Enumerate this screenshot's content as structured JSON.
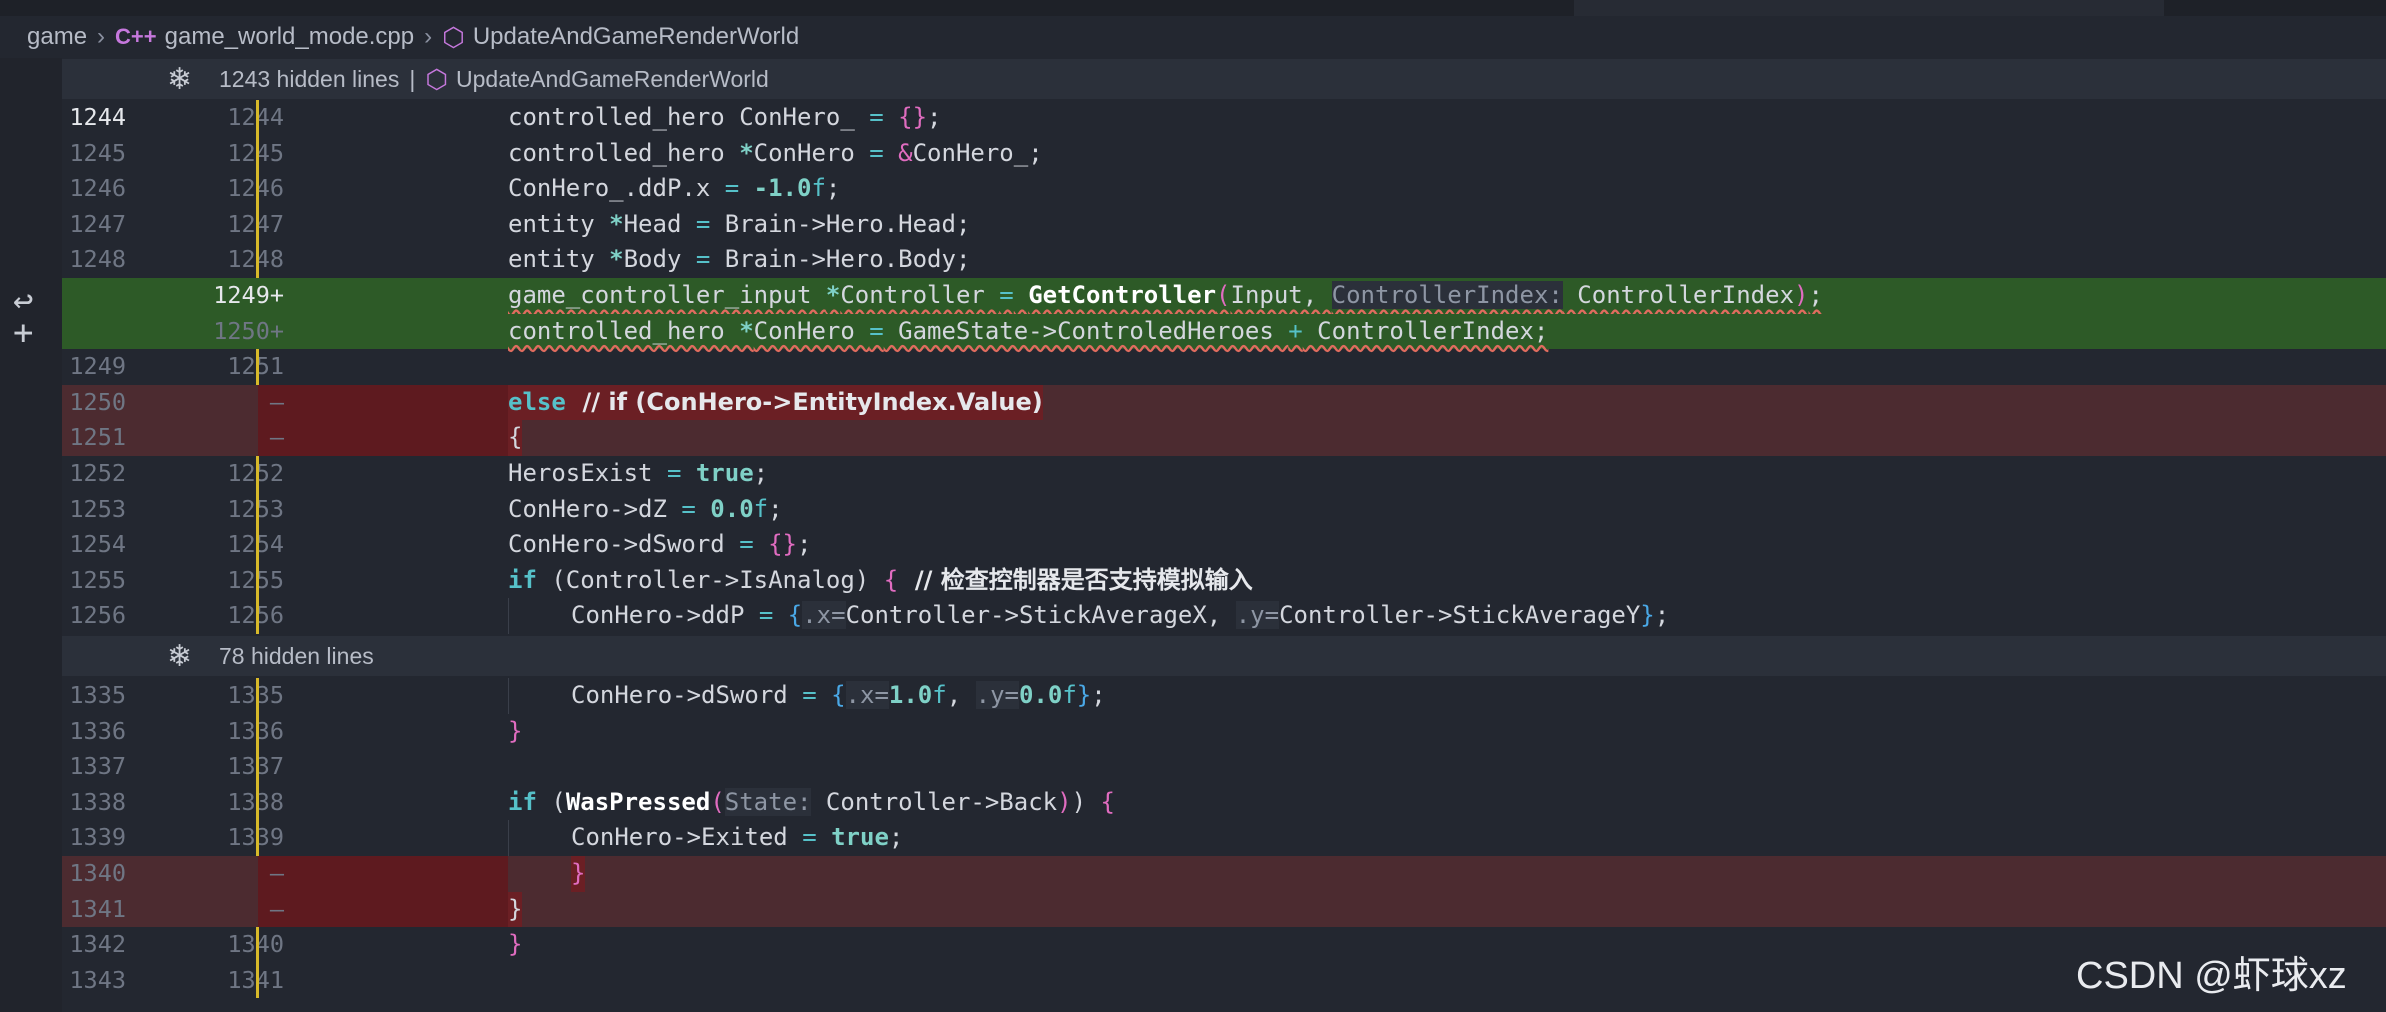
{
  "breadcrumb": {
    "folder": "game",
    "file": "game_world_mode.cpp",
    "file_icon": "C++",
    "symbol": "UpdateAndGameRenderWorld"
  },
  "banners": {
    "top": {
      "text": "1243 hidden lines",
      "symbol": "UpdateAndGameRenderWorld"
    },
    "mid": {
      "text": "78 hidden lines"
    }
  },
  "lines": [
    {
      "old": "1244",
      "new": "1244",
      "kind": "ctx",
      "active": true
    },
    {
      "old": "1245",
      "new": "1245",
      "kind": "ctx"
    },
    {
      "old": "1246",
      "new": "1246",
      "kind": "ctx"
    },
    {
      "old": "1247",
      "new": "1247",
      "kind": "ctx"
    },
    {
      "old": "1248",
      "new": "1248",
      "kind": "ctx"
    },
    {
      "old": "",
      "new": "1249+",
      "kind": "add",
      "active": true
    },
    {
      "old": "",
      "new": "1250+",
      "kind": "add"
    },
    {
      "old": "1249",
      "new": "1251",
      "kind": "ctx"
    },
    {
      "old": "1250",
      "new": "—",
      "kind": "del"
    },
    {
      "old": "1251",
      "new": "—",
      "kind": "del"
    },
    {
      "old": "1252",
      "new": "1252",
      "kind": "ctx"
    },
    {
      "old": "1253",
      "new": "1253",
      "kind": "ctx"
    },
    {
      "old": "1254",
      "new": "1254",
      "kind": "ctx"
    },
    {
      "old": "1255",
      "new": "1255",
      "kind": "ctx"
    },
    {
      "old": "1256",
      "new": "1256",
      "kind": "ctx"
    },
    {
      "old": "1335",
      "new": "1335",
      "kind": "ctx"
    },
    {
      "old": "1336",
      "new": "1336",
      "kind": "ctx"
    },
    {
      "old": "1337",
      "new": "1337",
      "kind": "ctx"
    },
    {
      "old": "1338",
      "new": "1338",
      "kind": "ctx"
    },
    {
      "old": "1339",
      "new": "1339",
      "kind": "ctx"
    },
    {
      "old": "1340",
      "new": "—",
      "kind": "del"
    },
    {
      "old": "1341",
      "new": "—",
      "kind": "del"
    },
    {
      "old": "1342",
      "new": "1340",
      "kind": "ctx"
    },
    {
      "old": "1343",
      "new": "1341",
      "kind": "ctx"
    }
  ],
  "code": {
    "l0": {
      "a": "controlled_hero ConHero_ ",
      "b": "=",
      "c": " ",
      "d": "{}",
      "e": ";"
    },
    "l1": {
      "a": "controlled_hero ",
      "b": "*",
      "c": "ConHero ",
      "d": "=",
      "e": " ",
      "f": "&",
      "g": "ConHero_;"
    },
    "l2": {
      "a": "ConHero_.ddP.x ",
      "b": "=",
      "c": " ",
      "d": "-1.0",
      "e": "f",
      "f": ";"
    },
    "l3": {
      "a": "entity ",
      "b": "*",
      "c": "Head ",
      "d": "=",
      "e": " Brain->Hero.Head;"
    },
    "l4": {
      "a": "entity ",
      "b": "*",
      "c": "Body ",
      "d": "=",
      "e": " Brain->Hero.Body;"
    },
    "l5": {
      "a": "game_controller_input ",
      "b": "*",
      "c": "Controller ",
      "d": "=",
      "e": " ",
      "f": "GetController",
      "g": "(",
      "h": "Input, ",
      "i": "ControllerIndex:",
      "j": " ControllerIndex",
      "k": ")",
      "l": ";"
    },
    "l6": {
      "a": "controlled_hero ",
      "b": "*",
      "c": "ConHero ",
      "d": "=",
      "e": " GameState->ControledHeroes ",
      "f": "+",
      "g": " ControllerIndex;"
    },
    "l8": {
      "a": "else",
      "b": "  // if (ConHero->EntityIndex.Value)"
    },
    "l9": {
      "a": "{"
    },
    "l10": {
      "a": "HerosExist ",
      "b": "=",
      "c": " ",
      "d": "true",
      "e": ";"
    },
    "l11": {
      "a": "ConHero->dZ ",
      "b": "=",
      "c": " ",
      "d": "0.0",
      "e": "f",
      "f": ";"
    },
    "l12": {
      "a": "ConHero->dSword ",
      "b": "=",
      "c": " ",
      "d": "{}",
      "e": ";"
    },
    "l13": {
      "a": "if",
      "b": " (Controller->IsAnalog) ",
      "c": "{",
      "d": "  // 检查控制器是否支持模拟输入"
    },
    "l14": {
      "a": "ConHero->ddP ",
      "b": "=",
      "c": " ",
      "d": "{",
      "e": ".x=",
      "f": "Controller->StickAverageX, ",
      "g": ".y=",
      "h": "Controller->StickAverageY",
      "i": "}",
      "j": ";"
    },
    "l15": {
      "a": "ConHero->dSword ",
      "b": "=",
      "c": " ",
      "d": "{",
      "e": ".x=",
      "f": "1.0",
      "g": "f",
      "h": ", ",
      "i": ".y=",
      "j": "0.0",
      "k": "f",
      "l": "}",
      "m": ";"
    },
    "l16": {
      "a": "}"
    },
    "l18": {
      "a": "if",
      "b": " (",
      "c": "WasPressed",
      "d": "(",
      "e": "State:",
      "f": " Controller->Back",
      "g": ")",
      "h": ") ",
      "i": "{"
    },
    "l19": {
      "a": "ConHero->Exited ",
      "b": "=",
      "c": " ",
      "d": "true",
      "e": ";"
    },
    "l20": {
      "a": "}"
    },
    "l21": {
      "a": "}"
    },
    "l22": {
      "a": "}"
    }
  },
  "watermark": "CSDN @虾球xz"
}
